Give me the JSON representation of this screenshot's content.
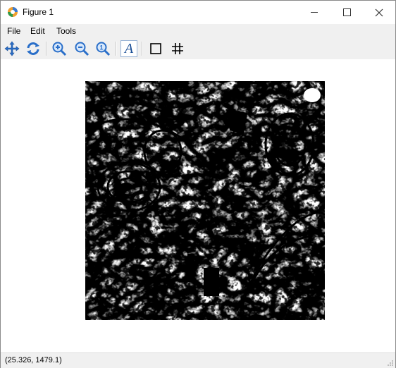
{
  "window": {
    "title": "Figure 1",
    "controls": {
      "minimize": "minimize-icon",
      "maximize": "maximize-icon",
      "close": "close-icon"
    }
  },
  "menu": {
    "items": [
      {
        "label": "File"
      },
      {
        "label": "Edit"
      },
      {
        "label": "Tools"
      }
    ]
  },
  "toolbar": {
    "tools": [
      {
        "icon": "pan-icon",
        "tooltip": ""
      },
      {
        "icon": "reset-icon",
        "tooltip": ""
      },
      {
        "icon": "zoom-in-icon",
        "tooltip": ""
      },
      {
        "icon": "zoom-out-icon",
        "tooltip": ""
      },
      {
        "icon": "zoom-fit-icon",
        "tooltip": ""
      },
      {
        "icon": "text-icon",
        "glyph": "A"
      },
      {
        "icon": "box-icon"
      },
      {
        "icon": "grid-icon"
      }
    ],
    "accent_blue": "#2a6fc9"
  },
  "canvas": {
    "image_description_colors": {
      "foreground": "#000000",
      "background": "#ffffff"
    }
  },
  "status": {
    "coordinates": "(25.326, 1479.1)"
  }
}
